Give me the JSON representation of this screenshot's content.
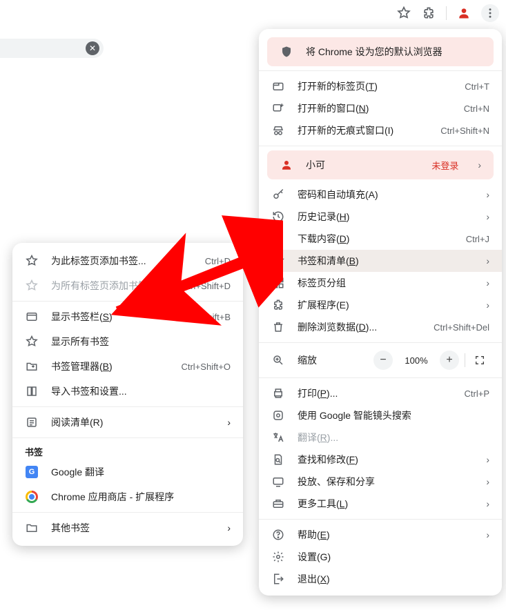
{
  "top": {
    "close_glyph": "✕"
  },
  "banner": {
    "text": "将 Chrome 设为您的默认浏览器"
  },
  "profile": {
    "name": "小可",
    "status": "未登录"
  },
  "main": {
    "new_tab": {
      "label": "打开新的标签页",
      "mn": "T",
      "shortcut": "Ctrl+T"
    },
    "new_window": {
      "label": "打开新的窗口",
      "mn": "N",
      "shortcut": "Ctrl+N"
    },
    "incognito": {
      "label": "打开新的无痕式窗口(I)",
      "shortcut": "Ctrl+Shift+N"
    },
    "passwords": {
      "label": "密码和自动填充(A)"
    },
    "history": {
      "label": "历史记录",
      "mn": "H"
    },
    "downloads": {
      "label": "下载内容",
      "mn": "D",
      "shortcut": "Ctrl+J"
    },
    "bookmarks": {
      "label": "书签和清单",
      "mn": "B"
    },
    "tab_groups": {
      "label": "标签页分组"
    },
    "extensions": {
      "label": "扩展程序(E)"
    },
    "clear_data": {
      "label": "删除浏览数据",
      "mn": "D",
      "suffix": "...",
      "shortcut": "Ctrl+Shift+Del"
    },
    "zoom": {
      "label": "缩放",
      "value": "100%"
    },
    "print": {
      "label": "打印",
      "mn": "P",
      "suffix": "...",
      "shortcut": "Ctrl+P"
    },
    "lens": {
      "label": "使用 Google 智能镜头搜索"
    },
    "translate": {
      "label": "翻译",
      "mn": "R",
      "suffix": "..."
    },
    "find": {
      "label": "查找和修改",
      "mn": "F"
    },
    "cast": {
      "label": "投放、保存和分享"
    },
    "more_tools": {
      "label": "更多工具",
      "mn": "L"
    },
    "help": {
      "label": "帮助",
      "mn": "E"
    },
    "settings": {
      "label": "设置(G)"
    },
    "exit": {
      "label": "退出",
      "mn": "X"
    }
  },
  "sub": {
    "add_bookmark": {
      "label": "为此标签页添加书签...",
      "shortcut": "Ctrl+D"
    },
    "add_all": {
      "label": "为所有标签页添加书签...",
      "shortcut": "Ctrl+Shift+D"
    },
    "show_bar": {
      "label": "显示书签栏",
      "mn": "S",
      "shortcut": "Ctrl+Shift+B"
    },
    "show_all": {
      "label": "显示所有书签"
    },
    "manager": {
      "label": "书签管理器",
      "mn": "B",
      "shortcut": "Ctrl+Shift+O"
    },
    "import": {
      "label": "导入书签和设置..."
    },
    "reading": {
      "label": "阅读清单(R)"
    },
    "heading": "书签",
    "bk_translate": {
      "label": "Google 翻译"
    },
    "bk_store": {
      "label": "Chrome 应用商店 - 扩展程序"
    },
    "other": {
      "label": "其他书签"
    }
  }
}
